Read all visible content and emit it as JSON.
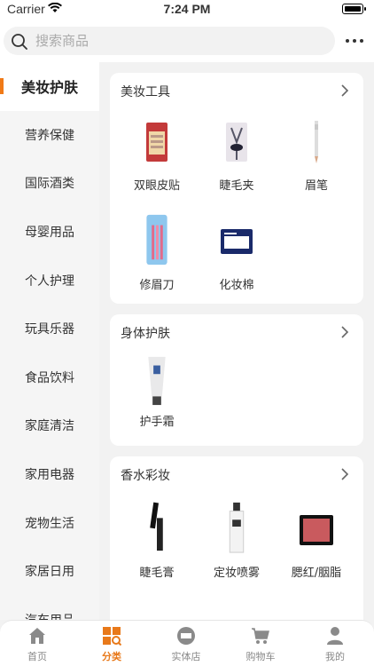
{
  "status_bar": {
    "carrier": "Carrier",
    "time": "7:24 PM"
  },
  "search": {
    "placeholder": "搜索商品"
  },
  "sidebar": {
    "items": [
      {
        "label": "美妆护肤",
        "active": true
      },
      {
        "label": "营养保健"
      },
      {
        "label": "国际酒类"
      },
      {
        "label": "母婴用品"
      },
      {
        "label": "个人护理"
      },
      {
        "label": "玩具乐器"
      },
      {
        "label": "食品饮料"
      },
      {
        "label": "家庭清洁"
      },
      {
        "label": "家用电器"
      },
      {
        "label": "宠物生活"
      },
      {
        "label": "家居日用"
      },
      {
        "label": "汽车用品"
      }
    ]
  },
  "sections": [
    {
      "title": "美妆工具",
      "items": [
        {
          "label": "双眼皮贴",
          "icon": "eyelid-tape-product"
        },
        {
          "label": "睫毛夹",
          "icon": "eyelash-curler-product"
        },
        {
          "label": "眉笔",
          "icon": "eyebrow-pencil-product"
        },
        {
          "label": "修眉刀",
          "icon": "eyebrow-razor-product"
        },
        {
          "label": "化妆棉",
          "icon": "cotton-pad-product"
        }
      ]
    },
    {
      "title": "身体护肤",
      "items": [
        {
          "label": "护手霜",
          "icon": "hand-cream-product"
        }
      ]
    },
    {
      "title": "香水彩妆",
      "items": [
        {
          "label": "睫毛膏",
          "icon": "mascara-product"
        },
        {
          "label": "定妆喷雾",
          "icon": "setting-spray-product"
        },
        {
          "label": "腮红/胭脂",
          "icon": "blush-product"
        }
      ]
    }
  ],
  "tabs": [
    {
      "label": "首页",
      "icon": "home-icon"
    },
    {
      "label": "分类",
      "icon": "category-icon",
      "active": true
    },
    {
      "label": "实体店",
      "icon": "store-icon"
    },
    {
      "label": "购物车",
      "icon": "cart-icon"
    },
    {
      "label": "我的",
      "icon": "user-icon"
    }
  ],
  "colors": {
    "accent": "#e8791a",
    "sidebar_bg": "#f5f5f5",
    "page_bg": "#f2f2f2"
  }
}
